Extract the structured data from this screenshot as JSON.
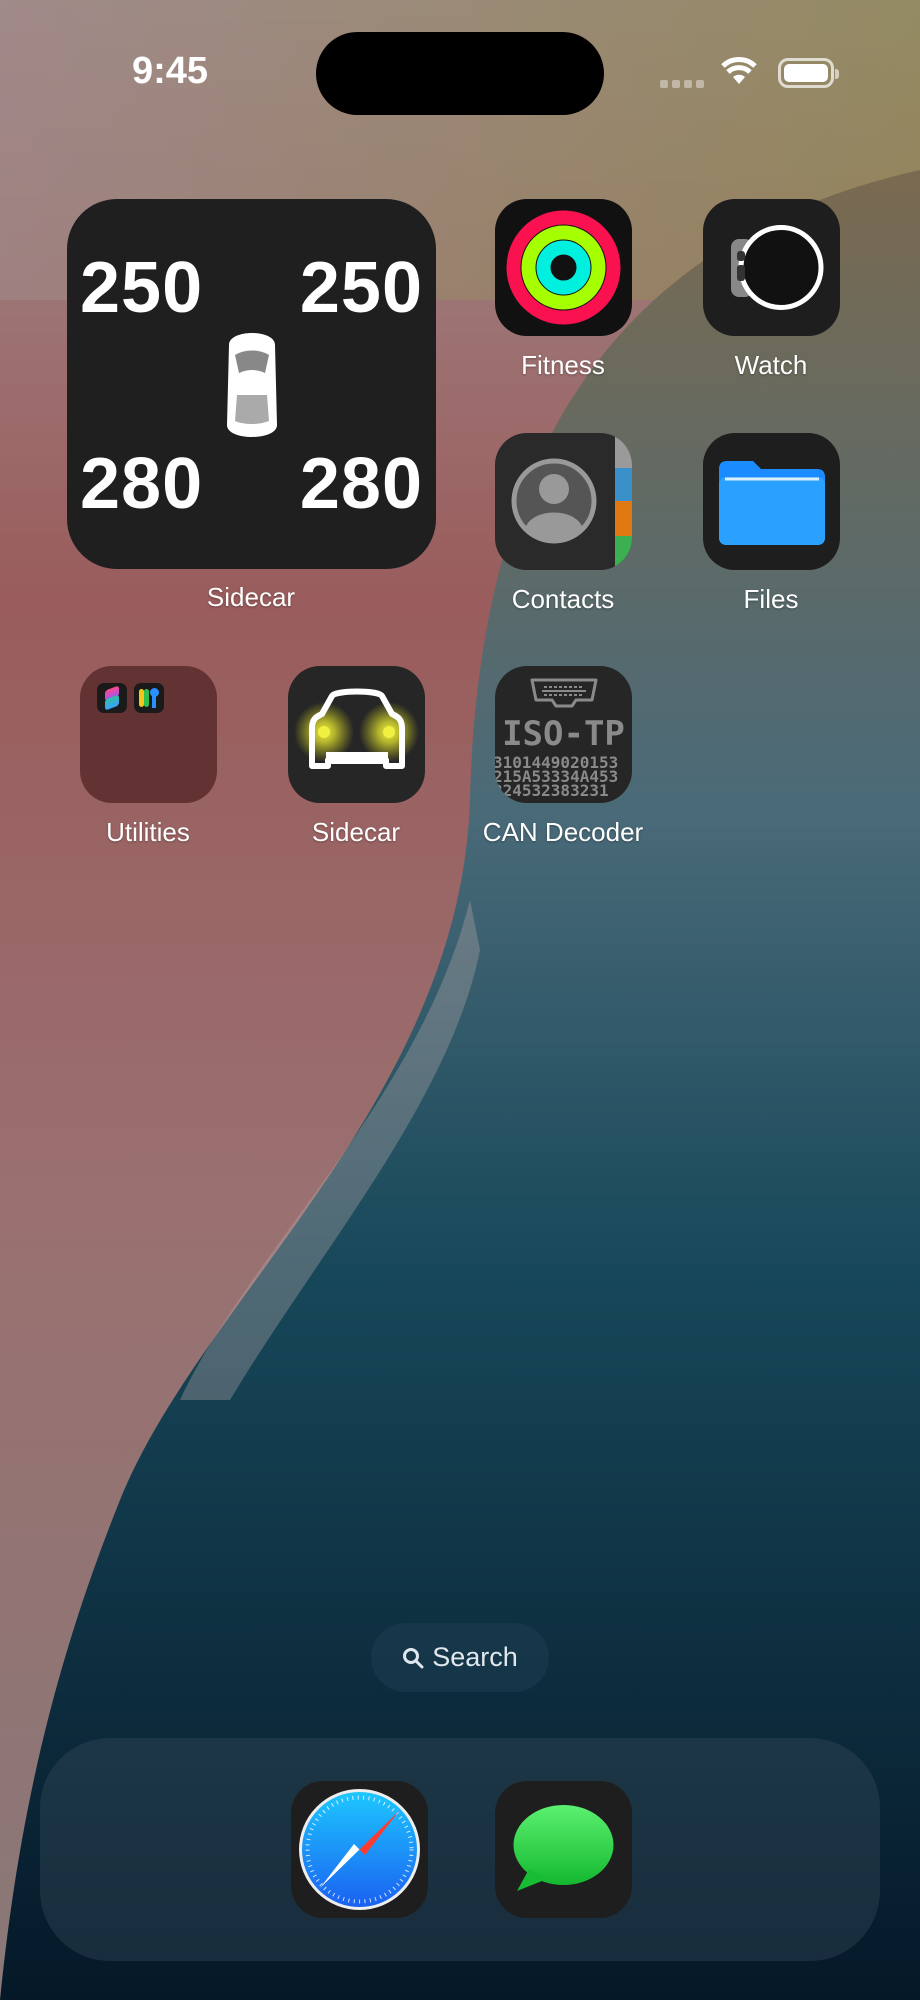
{
  "status_bar": {
    "time": "9:45",
    "wifi_icon": "wifi-icon",
    "battery_icon": "battery-icon"
  },
  "widget": {
    "label": "Sidecar",
    "front_left": "250",
    "front_right": "250",
    "rear_left": "280",
    "rear_right": "280"
  },
  "apps": [
    {
      "label": "Fitness",
      "icon": "activity-rings-icon"
    },
    {
      "label": "Watch",
      "icon": "watch-icon"
    },
    {
      "label": "Contacts",
      "icon": "contacts-icon"
    },
    {
      "label": "Files",
      "icon": "folder-icon"
    },
    {
      "label": "Utilities",
      "icon": "folder-group-icon"
    },
    {
      "label": "Sidecar",
      "icon": "car-headlights-icon"
    },
    {
      "label": "CAN Decoder",
      "icon": "obd-connector-icon"
    }
  ],
  "can_icon": {
    "title": "ISO-TP",
    "lines": [
      "3101449020153",
      "215A53334A453",
      "224532383231"
    ]
  },
  "search": {
    "label": "Search"
  },
  "dock": [
    {
      "icon": "safari-icon"
    },
    {
      "icon": "messages-icon"
    }
  ]
}
